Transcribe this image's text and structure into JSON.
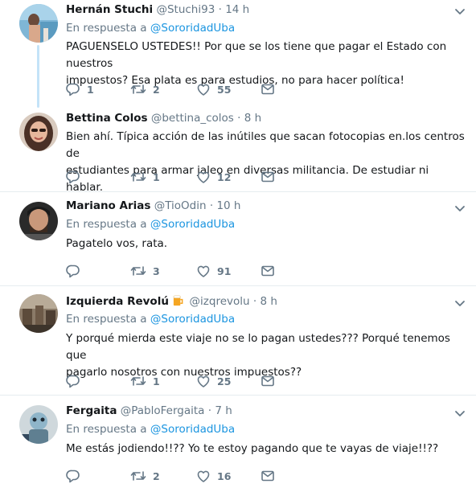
{
  "tweets": [
    {
      "name": "Hernán Stuchi",
      "handle": "@Stuchi93",
      "dot": "·",
      "time": "14 h",
      "reply_prefix": "En respuesta a",
      "reply_to": "@SororidadUba",
      "text": "PAGUENSELO USTEDES!! Por que se los tiene que pagar el Estado con nuestros\nimpuestos?  Esa plata es para estudios, no para hacer política!",
      "replies": "1",
      "retweets": "2",
      "likes": "55"
    },
    {
      "name": "Bettina Colos",
      "handle": "@bettina_colos",
      "dot": "·",
      "time": "8 h",
      "text": "Bien ahí. Típica acción de las inútiles que sacan fotocopias en.los centros de\nestudiantes para armar jaleo en diversas militancia. De estudiar ni hablar.",
      "replies": "",
      "retweets": "1",
      "likes": "12"
    },
    {
      "name": "Mariano Arias",
      "handle": "@TioOdin",
      "dot": "·",
      "time": "10 h",
      "reply_prefix": "En respuesta a",
      "reply_to": "@SororidadUba",
      "text": "Pagatelo vos, rata.",
      "replies": "",
      "retweets": "3",
      "likes": "91"
    },
    {
      "name": "Izquierda Revolú",
      "handle": "@izqrevolu",
      "dot": "·",
      "time": "8 h",
      "reply_prefix": "En respuesta a",
      "reply_to": "@SororidadUba",
      "text": "Y porqué mierda este viaje no se lo pagan ustedes??? Porqué tenemos que\npagarlo nosotros con nuestros impuestos??",
      "replies": "",
      "retweets": "1",
      "likes": "25"
    },
    {
      "name": "Fergaita",
      "handle": "@PabloFergaita",
      "dot": "·",
      "time": "7 h",
      "reply_prefix": "En respuesta a",
      "reply_to": "@SororidadUba",
      "text": "Me estás jodiendo!!?? Yo te estoy pagando que te vayas de viaje!!??",
      "replies": "",
      "retweets": "2",
      "likes": "16"
    }
  ],
  "colors": {
    "accent": "#1b95e0",
    "muted": "#657786",
    "divider": "#e6ecf0",
    "thread_line": "#c4e3f8"
  },
  "icons": [
    "reply-icon",
    "retweet-icon",
    "like-icon",
    "direct-message-icon",
    "chevron-down-icon",
    "beer-emoji-icon"
  ]
}
